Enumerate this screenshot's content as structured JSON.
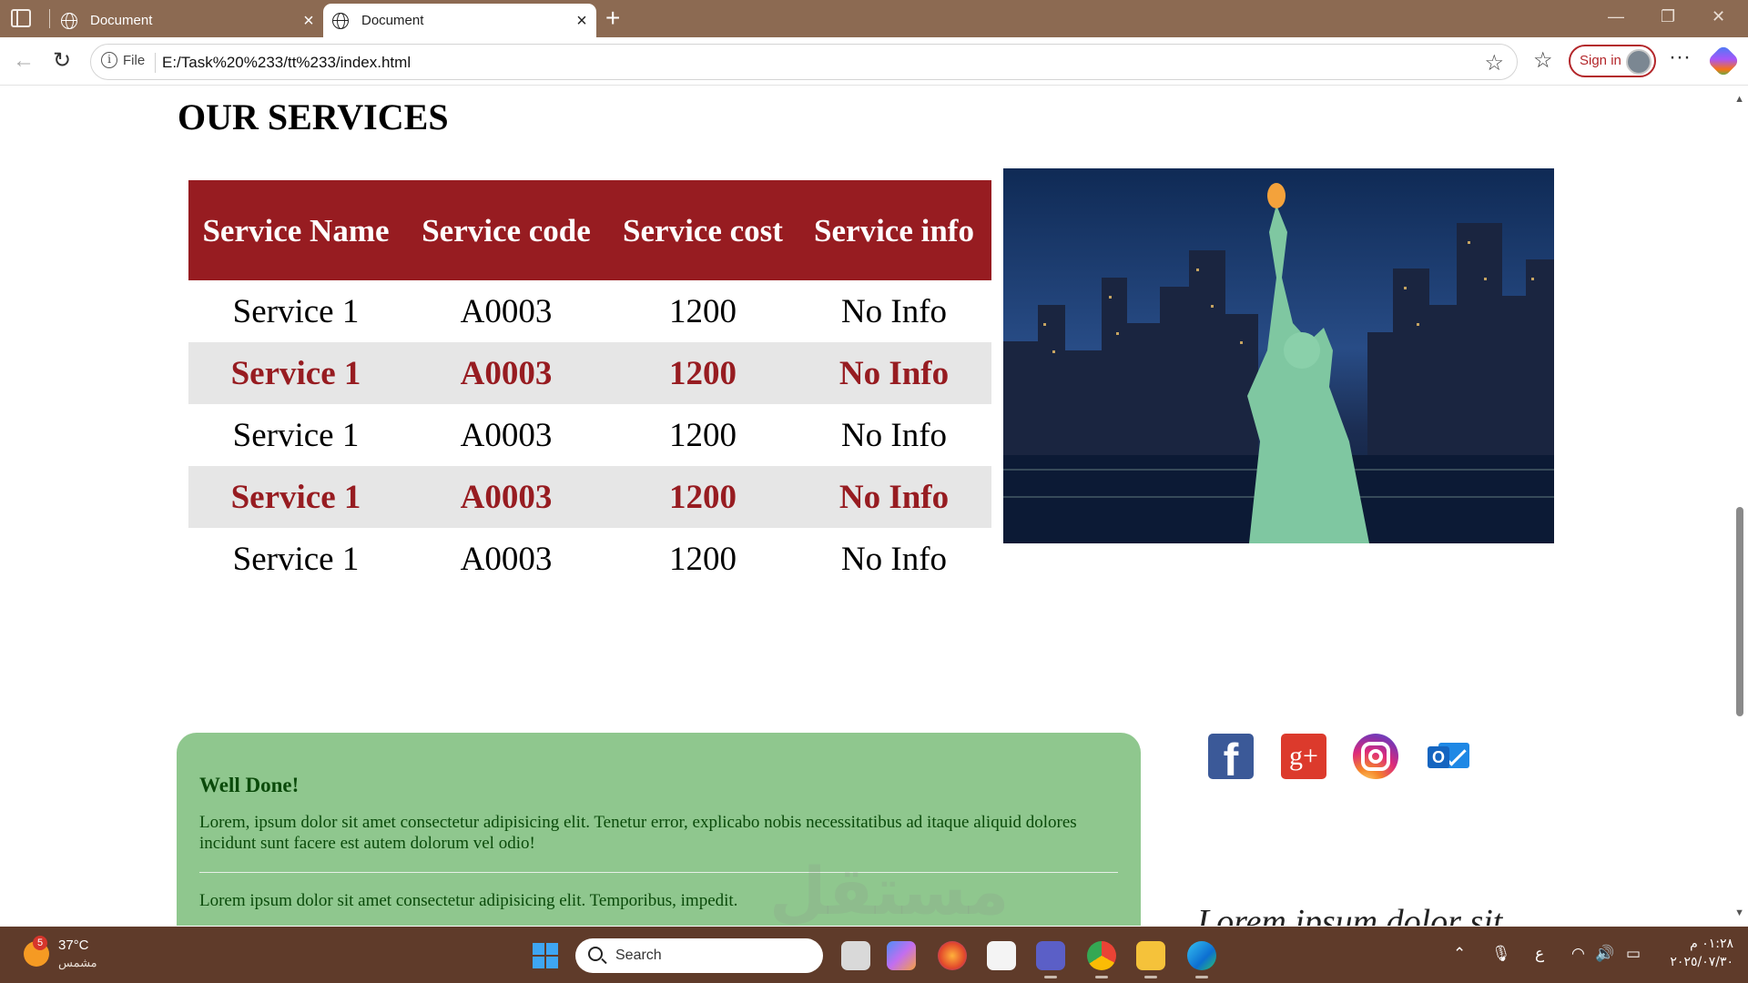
{
  "browser": {
    "tabs": [
      {
        "title": "Document",
        "active": false
      },
      {
        "title": "Document",
        "active": true
      }
    ],
    "address": {
      "scheme_label": "File",
      "url": "E:/Task%20%233/tt%233/index.html"
    },
    "signin_label": "Sign in"
  },
  "page": {
    "title": "OUR SERVICES",
    "table": {
      "headers": [
        "Service Name",
        "Service code",
        "Service cost",
        "Service info"
      ],
      "rows": [
        [
          "Service 1",
          "A0003",
          "1200",
          "No Info"
        ],
        [
          "Service 1",
          "A0003",
          "1200",
          "No Info"
        ],
        [
          "Service 1",
          "A0003",
          "1200",
          "No Info"
        ],
        [
          "Service 1",
          "A0003",
          "1200",
          "No Info"
        ],
        [
          "Service 1",
          "A0003",
          "1200",
          "No Info"
        ]
      ]
    },
    "alert": {
      "heading": "Well Done!",
      "paragraph1": "Lorem, ipsum dolor sit amet consectetur adipisicing elit. Tenetur error, explicabo nobis necessitatibus ad itaque aliquid dolores incidunt sunt facere est autem dolorum vel odio!",
      "paragraph2": "Lorem ipsum dolor sit amet consectetur adipisicing elit. Temporibus, impedit."
    },
    "social_icons": [
      "facebook-icon",
      "google-plus-icon",
      "instagram-icon",
      "outlook-icon"
    ],
    "social_labels": {
      "facebook": "f",
      "google_plus": "g+",
      "outlook": "O"
    },
    "side_heading": "Lorem ipsum dolor sit",
    "watermark": "مستقل"
  },
  "taskbar": {
    "weather": {
      "temp": "37°C",
      "desc": "مشمس",
      "badge": "5"
    },
    "search_label": "Search",
    "ime": "ع",
    "time": "٠١:٢٨ م",
    "date": "٢٠٢٥/٠٧/٣٠"
  },
  "colors": {
    "tab_bar": "#8c6a52",
    "table_header": "#971c21",
    "alt_row_bg": "#e6e6e6",
    "alert_bg": "#8fc78e",
    "taskbar": "#5f3b2a"
  }
}
